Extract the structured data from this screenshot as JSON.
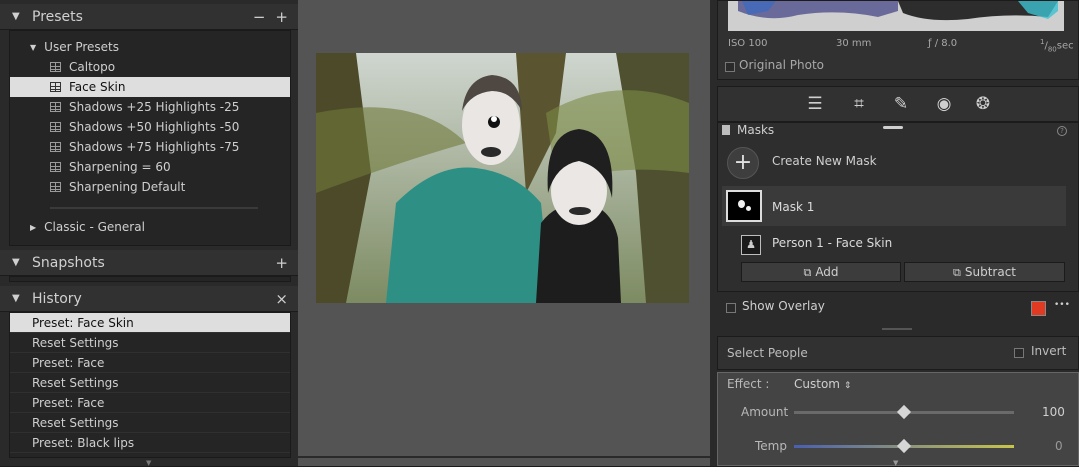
{
  "presets": {
    "title": "Presets",
    "minus": "−",
    "plus": "+",
    "user_presets": "User Presets",
    "items": [
      "Caltopo",
      "Face Skin",
      "Shadows +25 Highlights -25",
      "Shadows +50 Highlights -50",
      "Shadows +75 Highlights -75",
      "Sharpening = 60",
      "Sharpening Default"
    ],
    "selected_index": 1,
    "classic": "Classic - General"
  },
  "snapshots": {
    "title": "Snapshots",
    "plus": "+"
  },
  "history": {
    "title": "History",
    "close": "×",
    "items": [
      "Preset: Face Skin",
      "Reset Settings",
      "Preset: Face",
      "Reset Settings",
      "Preset: Face",
      "Reset Settings",
      "Preset: Black lips"
    ],
    "selected_index": 0
  },
  "info": {
    "iso": "ISO 100",
    "focal": "30 mm",
    "aperture": "ƒ / 8.0",
    "shutter_num": "1",
    "shutter_den": "80",
    "shutter_unit": "sec",
    "original_photo": "Original Photo"
  },
  "masks": {
    "title": "Masks",
    "create_new": "Create New Mask",
    "mask1": "Mask 1",
    "component": "Person 1 - Face Skin",
    "add": "Add",
    "subtract": "Subtract",
    "show_overlay": "Show Overlay",
    "overlay_color": "#e03a22",
    "more": "•••"
  },
  "select_people": {
    "label": "Select People",
    "invert": "Invert"
  },
  "effect": {
    "label": "Effect :",
    "value": "Custom",
    "amount_label": "Amount",
    "amount_value": "100",
    "amount_pos": 0.5,
    "temp_label": "Temp",
    "temp_value": "0",
    "temp_pos": 0.5
  }
}
